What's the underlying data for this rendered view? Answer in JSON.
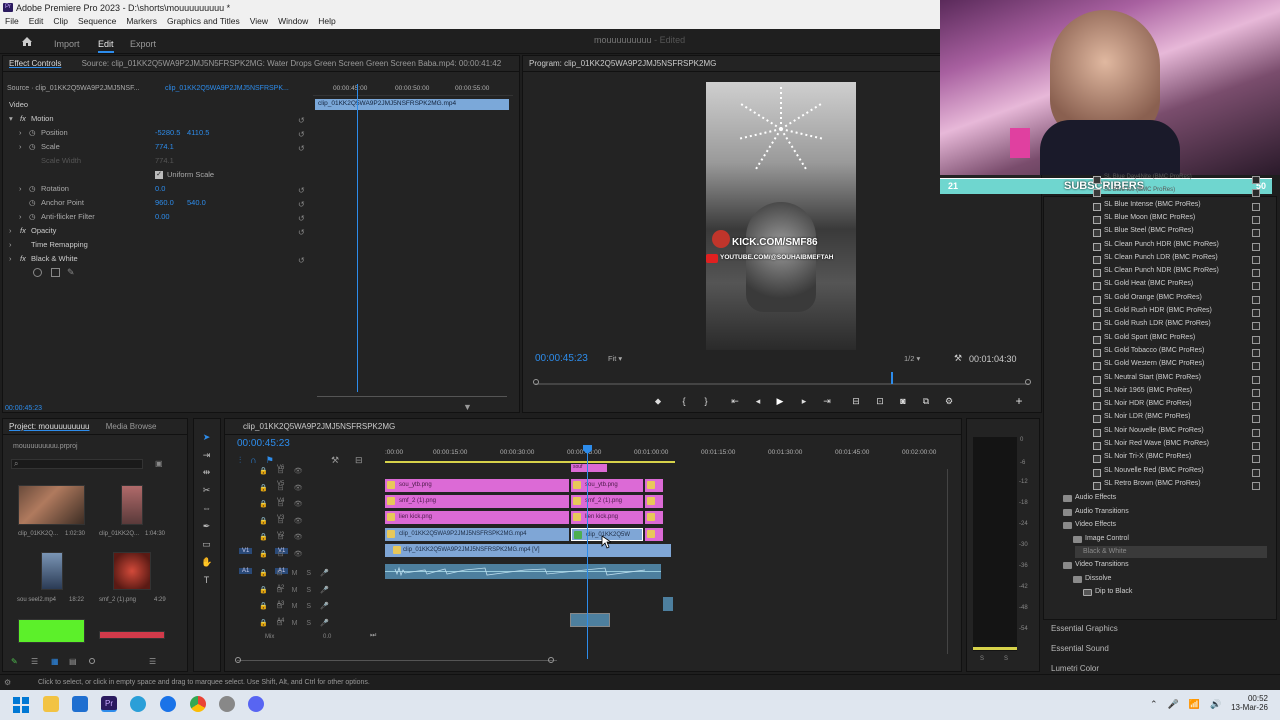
{
  "window": {
    "title": "Adobe Premiere Pro 2023 - D:\\shorts\\mouuuuuuuuu *",
    "app_icon": "Pr"
  },
  "menu": [
    "File",
    "Edit",
    "Clip",
    "Sequence",
    "Markers",
    "Graphics and Titles",
    "View",
    "Window",
    "Help"
  ],
  "nav": {
    "home": "home-icon",
    "import": "Import",
    "edit": "Edit",
    "export": "Export",
    "project_name": "mouuuuuuuuu",
    "status": "- Edited"
  },
  "effect_controls": {
    "tab": "Effect Controls",
    "source_tab": "Source: clip_01KK2Q5WA9P2JMJ5N5FRSPK2MG: Water Drops Green Screen Green Screen Baba.mp4: 00:00:41:42",
    "source_label": "Source · clip_01KK2Q5WA9P2JMJ5NSF...",
    "seq_label": "clip_01KK2Q5WA9P2JMJ5NSFRSPK...",
    "video": "Video",
    "motion": "Motion",
    "position": {
      "label": "Position",
      "x": "-5280.5",
      "y": "4110.5"
    },
    "scale": {
      "label": "Scale",
      "value": "774.1"
    },
    "scale_width": {
      "label": "Scale Width",
      "value": "774.1"
    },
    "uniform": "Uniform Scale",
    "rotation": {
      "label": "Rotation",
      "value": "0.0"
    },
    "anchor": {
      "label": "Anchor Point",
      "x": "960.0",
      "y": "540.0"
    },
    "antiflicker": {
      "label": "Anti-flicker Filter",
      "value": "0.00"
    },
    "opacity": "Opacity",
    "time_remap": "Time Remapping",
    "bw": "Black & White",
    "timecode": "00:00:45:23",
    "ruler": [
      "00:00:45:00",
      "00:00:50:00",
      "00:00:55:00"
    ],
    "clip": "clip_01KK2Q5WA9P2JMJ5NSFRSPK2MG.mp4"
  },
  "program": {
    "title": "Program: clip_01KK2Q5WA9P2JMJ5NSFRSPK2MG",
    "timecode": "00:00:45:23",
    "fit": "Fit",
    "ratio": "1/2",
    "duration": "00:01:04:30",
    "overlay_1": "KICK.COM/SMF86",
    "overlay_2": "YOUTUBE.COM/@SOUHAIBMEFTAH",
    "playhead_fraction": 0.72
  },
  "project": {
    "tab": "Project: mouuuuuuuuu",
    "media_tab": "Media Browse",
    "file": "mouuuuuuuuu.prproj",
    "items": [
      {
        "name": "clip_01KK2Q...",
        "dur": "1:02:30"
      },
      {
        "name": "clip_01KK2Q...",
        "dur": "1:04:30"
      },
      {
        "name": "sou seel2.mp4",
        "dur": "18:22"
      },
      {
        "name": "smf_2 (1).png",
        "dur": "4:29"
      }
    ]
  },
  "timeline": {
    "tab": "clip_01KK2Q5WA9P2JMJ5NSFRSPK2MG",
    "timecode": "00:00:45:23",
    "ruler": [
      ":00:00",
      "00:00:15:00",
      "00:00:30:00",
      "00:00:45:00",
      "00:01:00:00",
      "00:01:15:00",
      "00:01:30:00",
      "00:01:45:00",
      "00:02:00:00"
    ],
    "tracks_v": [
      "V6",
      "V5",
      "V4",
      "V3",
      "V2",
      "V1"
    ],
    "tracks_a": [
      "A1",
      "A2",
      "A3",
      "A4"
    ],
    "mix": "Mix",
    "mix_val": "0.0",
    "clips": {
      "v6b": "souf",
      "v5a": "sou_ytb.png",
      "v5b": "sou_ytb.png",
      "v4a": "smf_2 (1).png",
      "v4b": "smf_2 (1).png",
      "v3a": "lien kick.png",
      "v3b": "lien kick.png",
      "v2a": "clip_01KK2Q5WA9P2JMJ5NSFRSPK2MG.mp4",
      "v2b": "clip_01KK2Q5W",
      "v1": "clip_01KK2Q5WA9P2JMJ5NSFRSPK2MG.mp4 [V]"
    }
  },
  "meters": [
    "-12",
    "-18",
    "-24",
    "-30",
    "-36",
    "-42",
    "-48",
    "-54"
  ],
  "meter_ticks": [
    "0",
    "-6"
  ],
  "meter_s": [
    "S",
    "S"
  ],
  "stream": {
    "left": "21",
    "label": "SUBSCRIBERS",
    "right": "50"
  },
  "effects": {
    "luts": [
      "SL Blue Day4Nite (BMC ProRes)",
      "SL Blue Ice (BMC ProRes)",
      "SL Blue Intense (BMC ProRes)",
      "SL Blue Moon (BMC ProRes)",
      "SL Blue Steel (BMC ProRes)",
      "SL Clean Punch HDR (BMC ProRes)",
      "SL Clean Punch LDR (BMC ProRes)",
      "SL Clean Punch NDR (BMC ProRes)",
      "SL Gold Heat (BMC ProRes)",
      "SL Gold Orange (BMC ProRes)",
      "SL Gold Rush HDR (BMC ProRes)",
      "SL Gold Rush LDR (BMC ProRes)",
      "SL Gold Sport (BMC ProRes)",
      "SL Gold Tobacco (BMC ProRes)",
      "SL Gold Western (BMC ProRes)",
      "SL Neutral Start (BMC ProRes)",
      "SL Noir 1965 (BMC ProRes)",
      "SL Noir HDR (BMC ProRes)",
      "SL Noir LDR (BMC ProRes)",
      "SL Noir Nouvelle (BMC ProRes)",
      "SL Noir Red Wave (BMC ProRes)",
      "SL Noir Tri-X (BMC ProRes)",
      "SL Nouvelle Red (BMC ProRes)",
      "SL Retro Brown (BMC ProRes)"
    ],
    "audio_effects": "Audio Effects",
    "audio_transitions": "Audio Transitions",
    "video_effects": "Video Effects",
    "image_control": "Image Control",
    "bw_effect": "Black & White",
    "video_transitions": "Video Transitions",
    "dissolve": "Dissolve",
    "dip": "Dip to Black",
    "tabs": [
      "Essential Graphics",
      "Essential Sound",
      "Lumetri Color"
    ]
  },
  "status": "Click to select, or click in empty space and drag to marquee select. Use Shift, Alt, and Ctrl for other options.",
  "taskbar": {
    "time": "00:52",
    "date": "13-Mar-26"
  },
  "colors": {
    "accent": "#2d8ceb",
    "pink_clip": "#dc6ad6",
    "blue_clip": "#7fa6d6",
    "audio_clip": "#4d9e6e",
    "subs_bar": "#6fd6cf"
  }
}
